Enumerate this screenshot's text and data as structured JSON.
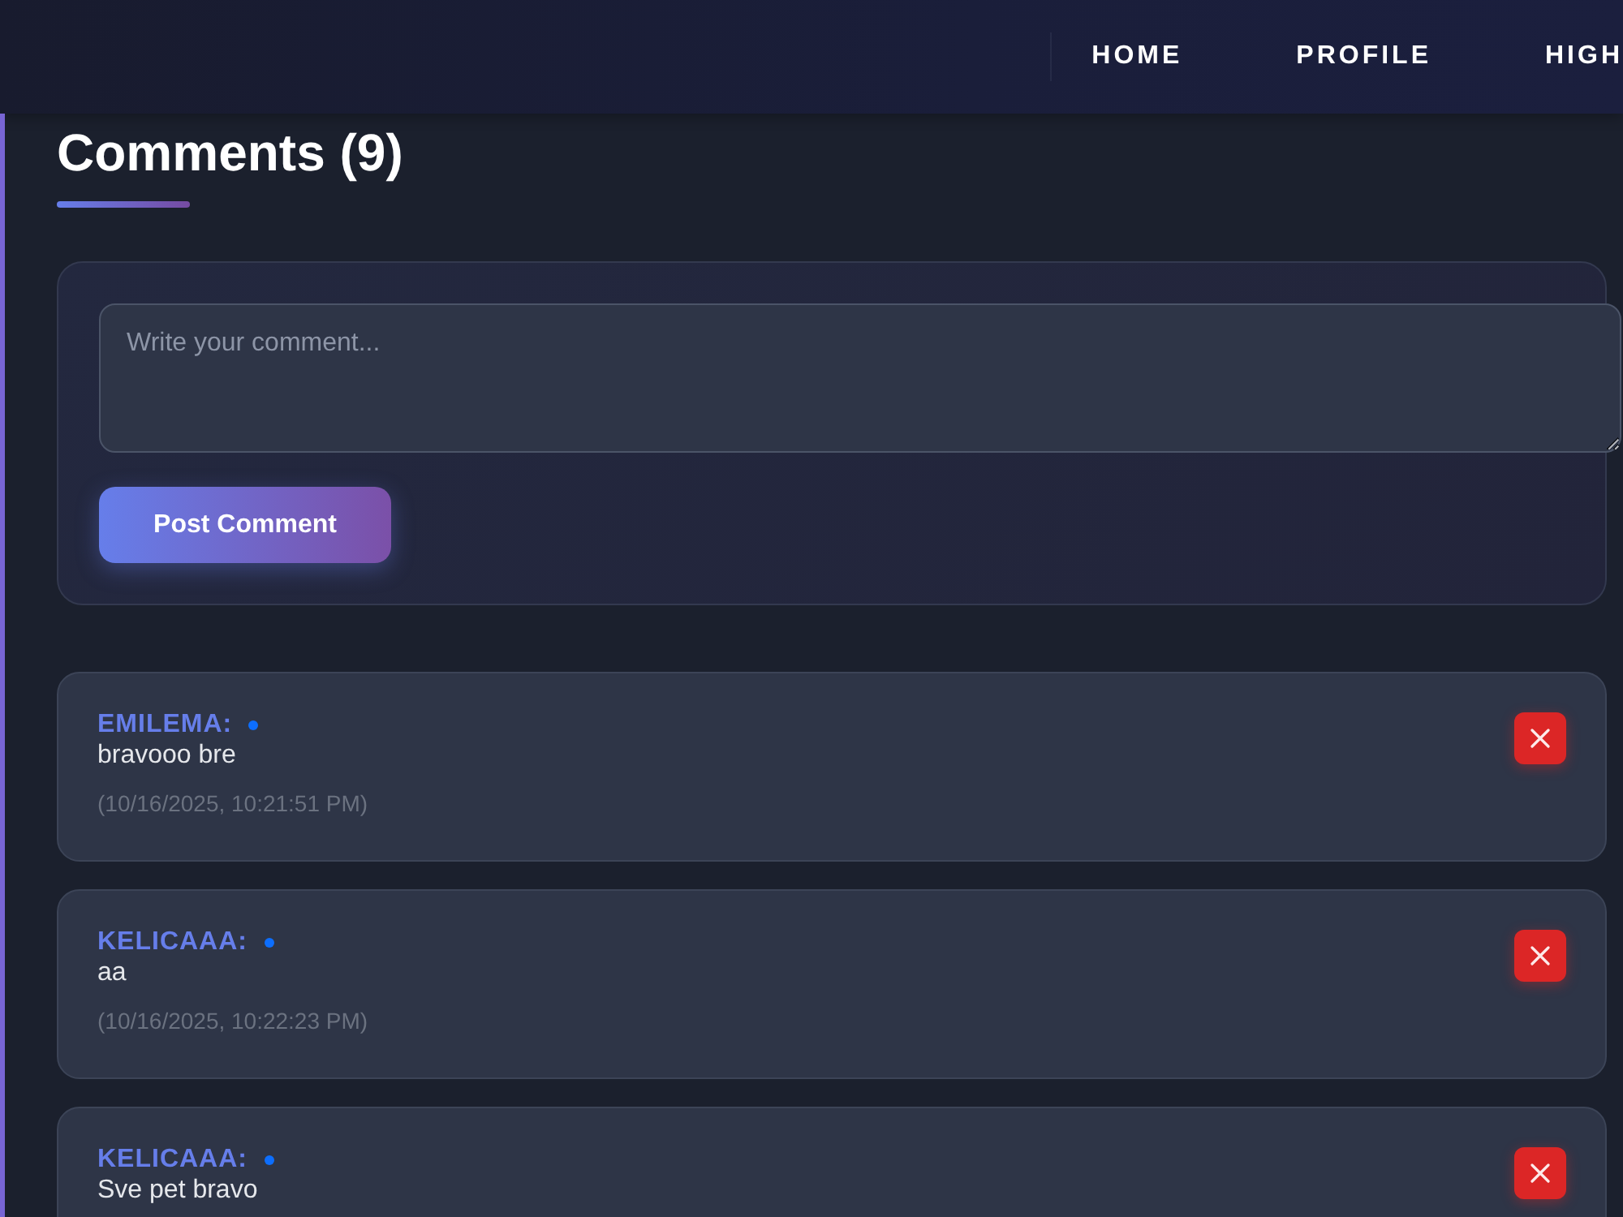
{
  "nav": {
    "links": [
      {
        "label": "HOME"
      },
      {
        "label": "PROFILE"
      },
      {
        "label": "HIGH"
      }
    ]
  },
  "comments_section": {
    "title": "Comments (9)",
    "form": {
      "placeholder": "Write your comment...",
      "submit_label": "Post Comment"
    },
    "comments": [
      {
        "author": "EMILEMA:",
        "online": true,
        "text": "bravooo bre",
        "time": "(10/16/2025, 10:21:51 PM)"
      },
      {
        "author": "KELICAAA:",
        "online": true,
        "text": "aa",
        "time": "(10/16/2025, 10:22:23 PM)"
      },
      {
        "author": "KELICAAA:",
        "online": true,
        "text": "Sve pet bravo"
      }
    ]
  }
}
